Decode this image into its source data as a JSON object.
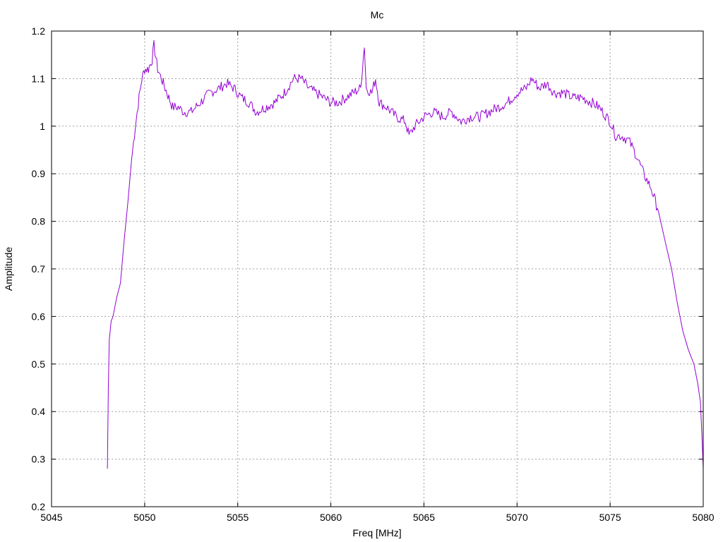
{
  "chart_data": {
    "type": "line",
    "title": "Mc",
    "xlabel": "Freq [MHz]",
    "ylabel": "Amplitude",
    "xlim": [
      5045,
      5080
    ],
    "ylim": [
      0.2,
      1.2
    ],
    "xticks": [
      "5045",
      "5050",
      "5055",
      "5060",
      "5065",
      "5070",
      "5075",
      "5080"
    ],
    "yticks": [
      "0.2",
      "0.3",
      "0.4",
      "0.5",
      "0.6",
      "0.7",
      "0.8",
      "0.9",
      "1",
      "1.1",
      "1.2"
    ],
    "grid": true,
    "legend": "none",
    "series": [
      {
        "color": "#9400d3",
        "x": [
          5048.0,
          5048.05,
          5048.1,
          5048.2,
          5048.3,
          5048.5,
          5048.7,
          5048.9,
          5049.1,
          5049.3,
          5049.5,
          5049.7,
          5049.85,
          5050.0,
          5050.2,
          5050.4,
          5050.5,
          5050.7,
          5050.9,
          5051.1,
          5051.3,
          5051.5,
          5051.8,
          5052.1,
          5052.5,
          5053.0,
          5053.5,
          5054.0,
          5054.4,
          5054.8,
          5055.2,
          5055.6,
          5056.0,
          5056.5,
          5057.0,
          5057.5,
          5058.0,
          5058.4,
          5058.8,
          5059.2,
          5059.6,
          5060.0,
          5060.4,
          5060.8,
          5061.2,
          5061.6,
          5061.8,
          5061.9,
          5062.2,
          5062.4,
          5062.6,
          5063.0,
          5063.5,
          5064.0,
          5064.2,
          5064.5,
          5065.0,
          5065.5,
          5066.0,
          5066.5,
          5067.0,
          5067.5,
          5068.0,
          5068.5,
          5069.0,
          5069.5,
          5070.0,
          5070.5,
          5070.8,
          5071.2,
          5071.6,
          5072.0,
          5072.5,
          5073.0,
          5073.5,
          5074.0,
          5074.4,
          5074.8,
          5075.0,
          5075.3,
          5075.6,
          5076.0,
          5076.4,
          5076.8,
          5077.2,
          5077.6,
          5078.0,
          5078.3,
          5078.6,
          5078.9,
          5079.2,
          5079.5,
          5079.7,
          5079.85,
          5079.95,
          5080.0
        ],
        "y": [
          0.28,
          0.45,
          0.55,
          0.59,
          0.6,
          0.64,
          0.67,
          0.76,
          0.84,
          0.93,
          1.0,
          1.06,
          1.1,
          1.12,
          1.12,
          1.14,
          1.17,
          1.12,
          1.1,
          1.08,
          1.06,
          1.04,
          1.04,
          1.03,
          1.03,
          1.05,
          1.07,
          1.08,
          1.09,
          1.08,
          1.06,
          1.05,
          1.03,
          1.04,
          1.05,
          1.07,
          1.1,
          1.1,
          1.08,
          1.07,
          1.06,
          1.05,
          1.05,
          1.06,
          1.07,
          1.08,
          1.17,
          1.08,
          1.07,
          1.1,
          1.05,
          1.04,
          1.02,
          1.01,
          0.98,
          1.0,
          1.02,
          1.03,
          1.02,
          1.03,
          1.01,
          1.02,
          1.02,
          1.03,
          1.04,
          1.05,
          1.07,
          1.08,
          1.1,
          1.08,
          1.09,
          1.07,
          1.07,
          1.06,
          1.06,
          1.05,
          1.04,
          1.02,
          1.01,
          0.98,
          0.98,
          0.97,
          0.94,
          0.9,
          0.87,
          0.82,
          0.75,
          0.7,
          0.63,
          0.57,
          0.53,
          0.5,
          0.46,
          0.42,
          0.33,
          0.28
        ]
      }
    ]
  }
}
